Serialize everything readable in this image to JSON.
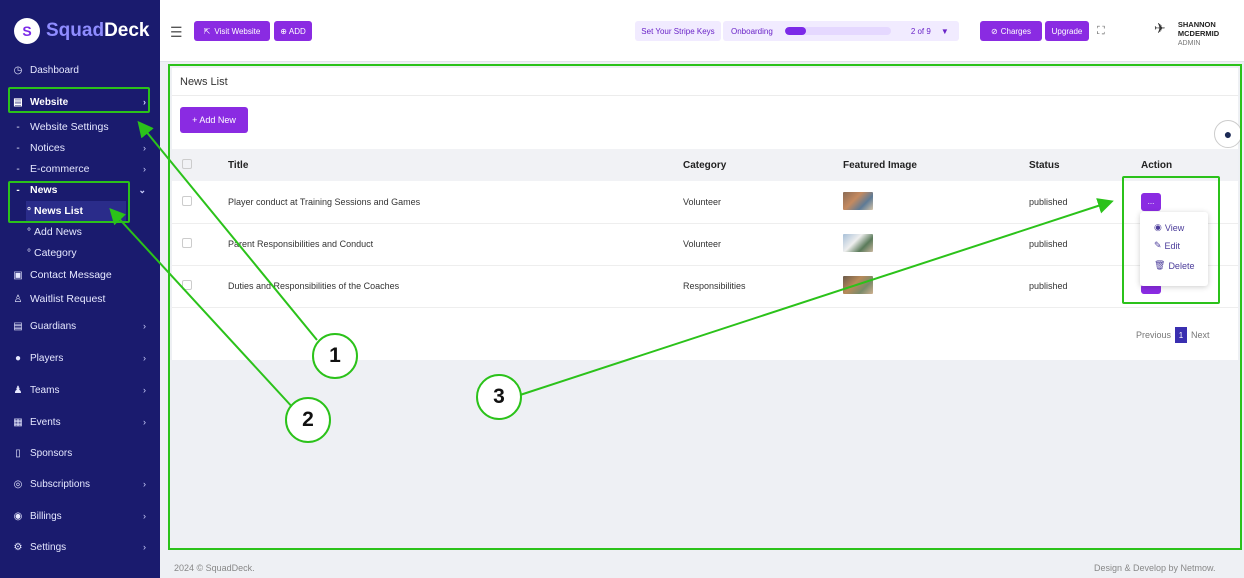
{
  "brand": {
    "squad": "Squad",
    "deck": "Deck"
  },
  "sidebar": {
    "items": [
      {
        "label": "Dashboard",
        "icon": "dashboard-icon"
      },
      {
        "label": "Website",
        "icon": "layout-icon"
      },
      {
        "label": "Website Settings"
      },
      {
        "label": "Notices"
      },
      {
        "label": "E-commerce"
      },
      {
        "label": "News"
      },
      {
        "label": "News List"
      },
      {
        "label": "Add News"
      },
      {
        "label": "Category"
      },
      {
        "label": "Contact Message",
        "icon": "message-icon"
      },
      {
        "label": "Waitlist Request",
        "icon": "user-icon"
      },
      {
        "label": "Guardians",
        "icon": "guardians-icon"
      },
      {
        "label": "Players",
        "icon": "player-icon"
      },
      {
        "label": "Teams",
        "icon": "teams-icon"
      },
      {
        "label": "Events",
        "icon": "calendar-icon"
      },
      {
        "label": "Sponsors",
        "icon": "sponsor-icon"
      },
      {
        "label": "Subscriptions",
        "icon": "subscriptions-icon"
      },
      {
        "label": "Billings",
        "icon": "billing-icon"
      },
      {
        "label": "Settings",
        "icon": "gear-icon"
      }
    ]
  },
  "topbar": {
    "visit_website": "Visit Website",
    "add": "ADD",
    "stripe": "Set Your Stripe Keys",
    "onboarding": "Onboarding",
    "onboarding_progress": 0.2,
    "steps": "2 of 9",
    "charges": "Charges",
    "upgrade": "Upgrade",
    "user_name": "SHANNON MCDERMID",
    "user_role": "ADMIN"
  },
  "page": {
    "title": "News List",
    "add_new": "+ Add New",
    "columns": [
      "Title",
      "Category",
      "Featured Image",
      "Status",
      "Action"
    ],
    "rows": [
      {
        "title": "Player conduct at Training Sessions and Games",
        "category": "Volunteer",
        "status": "published"
      },
      {
        "title": "Parent Responsibilities and Conduct",
        "category": "Volunteer",
        "status": "published"
      },
      {
        "title": "Duties and Responsibilities of the Coaches",
        "category": "Responsibilities",
        "status": "published"
      }
    ],
    "action_label": "...",
    "dropdown": {
      "view": "View",
      "edit": "Edit",
      "delete": "Delete"
    },
    "pager": {
      "previous": "Previous",
      "current": "1",
      "next": "Next"
    }
  },
  "footer": {
    "left": "2024 © SquadDeck.",
    "right": "Design & Develop by Netmow."
  },
  "annotations": {
    "one": "1",
    "two": "2",
    "three": "3"
  },
  "colors": {
    "sidebar": "#1a1b6e",
    "accent": "#8a2be2",
    "annotation": "#2bc21a"
  }
}
